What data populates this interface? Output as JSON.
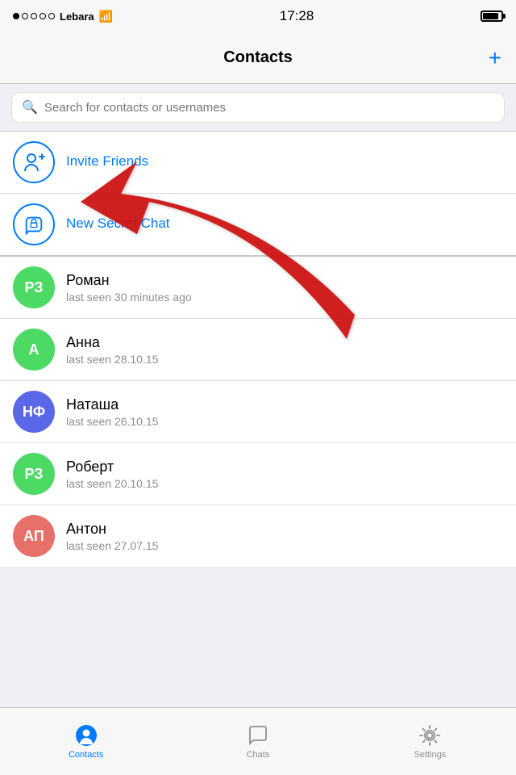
{
  "statusBar": {
    "carrier": "Lebara",
    "time": "17:28",
    "signal": [
      true,
      false,
      false,
      false,
      false
    ]
  },
  "navBar": {
    "title": "Contacts",
    "addButton": "+"
  },
  "search": {
    "placeholder": "Search for contacts or usernames"
  },
  "actions": [
    {
      "id": "invite-friends",
      "label": "Invite Friends",
      "iconType": "person-add"
    },
    {
      "id": "new-secret-chat",
      "label": "New Secret Chat",
      "iconType": "lock-bubble"
    }
  ],
  "contacts": [
    {
      "id": "roman",
      "initials": "РЗ",
      "name": "Роман",
      "status": "last seen 30 minutes ago",
      "color": "#4cd964"
    },
    {
      "id": "anna",
      "initials": "А",
      "name": "Анна",
      "status": "last seen 28.10.15",
      "color": "#4cd964"
    },
    {
      "id": "natasha",
      "initials": "НФ",
      "name": "Наташа",
      "status": "last seen 26.10.15",
      "color": "#5a67e8"
    },
    {
      "id": "robert",
      "initials": "РЗ",
      "name": "Роберт",
      "status": "last seen 20.10.15",
      "color": "#4cd964"
    },
    {
      "id": "anton",
      "initials": "АП",
      "name": "Антон",
      "status": "last seen 27.07.15",
      "color": "#e8706a"
    }
  ],
  "tabs": [
    {
      "id": "contacts",
      "label": "Contacts",
      "active": true
    },
    {
      "id": "chats",
      "label": "Chats",
      "active": false
    },
    {
      "id": "settings",
      "label": "Settings",
      "active": false
    }
  ]
}
